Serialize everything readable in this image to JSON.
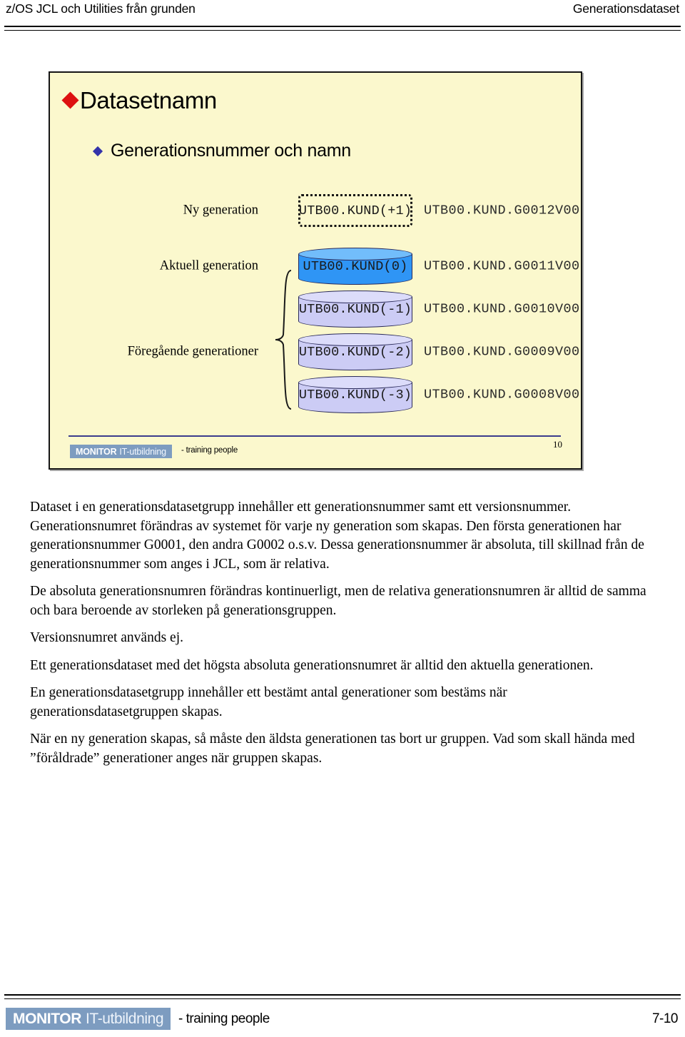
{
  "page_header": {
    "left_title": "z/OS JCL och Utilities från grunden",
    "right_title": "Generationsdataset"
  },
  "slide": {
    "title": "Datasetnamn",
    "subtitle": "Generationsnummer och namn",
    "colors": {
      "background": "#fbf8cd",
      "border": "#151515",
      "title_bullet": "#dd1111",
      "subtitle_bullet": "#3333aa",
      "current_cylinder": "#2f95f5",
      "previous_cylinder": "#ccccf5",
      "rule": "#3b3b8c",
      "logo_box": "#7d9cc0"
    },
    "diagram": {
      "rows": [
        {
          "label": "Ny generation",
          "relative_name": "UTB00.KUND(+1)",
          "absolute_name": "UTB00.KUND.G0012V00",
          "shape": "dotted-box"
        },
        {
          "label": "Aktuell generation",
          "relative_name": "UTB00.KUND(0)",
          "absolute_name": "UTB00.KUND.G0011V00",
          "shape": "cylinder-blue"
        },
        {
          "label": "",
          "relative_name": "UTB00.KUND(-1)",
          "absolute_name": "UTB00.KUND.G0010V00",
          "shape": "cylinder-lavender"
        },
        {
          "label": "Föregående generationer",
          "relative_name": "UTB00.KUND(-2)",
          "absolute_name": "UTB00.KUND.G0009V00",
          "shape": "cylinder-lavender"
        },
        {
          "label": "",
          "relative_name": "UTB00.KUND(-3)",
          "absolute_name": "UTB00.KUND.G0008V00",
          "shape": "cylinder-lavender"
        }
      ]
    },
    "footer": {
      "logo_primary": "MONITOR",
      "logo_secondary": "IT-utbildning",
      "tagline": "- training people",
      "page_number": "10"
    }
  },
  "body_paragraphs": [
    "Dataset i en generationsdatasetgrupp innehåller ett generationsnummer samt ett versionsnummer. Generationsnumret förändras av systemet för varje ny generation som skapas. Den första generationen har generationsnummer G0001, den andra G0002 o.s.v. Dessa generationsnummer är absoluta, till skillnad från de generationsnummer som anges i JCL, som är relativa.",
    "De absoluta generationsnumren förändras kontinuerligt, men de relativa generationsnumren är alltid de samma och bara beroende av storleken på generationsgruppen.",
    "Versionsnumret används ej.",
    "Ett generationsdataset med det högsta absoluta generationsnumret är alltid den aktuella generationen.",
    "En generationsdatasetgrupp innehåller ett bestämt antal generationer som bestäms när generationsdatasetgruppen skapas.",
    "När en ny generation skapas, så måste den äldsta generationen tas bort ur gruppen. Vad som skall hända med ”föråldrade” generationer anges när gruppen skapas."
  ],
  "page_footer": {
    "logo_primary": "MONITOR",
    "logo_secondary": "IT-utbildning",
    "tagline": "- training people",
    "page_number": "7-10"
  }
}
